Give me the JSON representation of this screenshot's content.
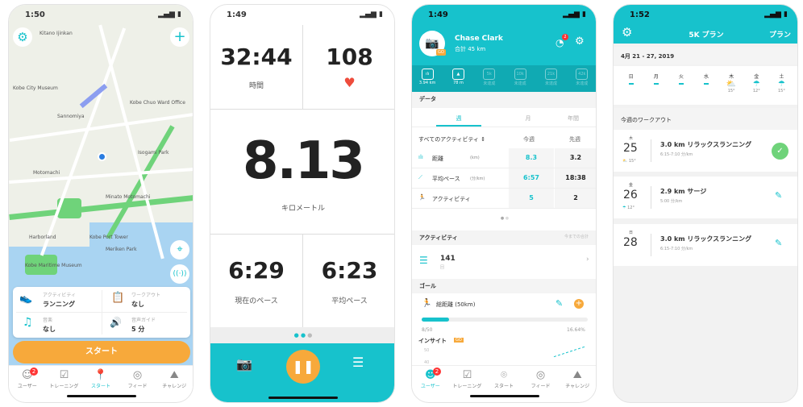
{
  "phone1": {
    "time": "1:50",
    "map_labels": [
      "Kitano Ijinkan",
      "Kobe City Museum",
      "Sannomiya",
      "Harborland",
      "Kobe Port Tower",
      "Meriken Park",
      "Isogami Park",
      "Motomachi",
      "Minato Motomachi",
      "Kobe Chuo Ward Office",
      "Kobe Maritime Museum"
    ],
    "card": [
      {
        "icon": "shoe-icon",
        "label": "アクティビティ",
        "value": "ランニング"
      },
      {
        "icon": "clipboard-icon",
        "label": "ワークアウト",
        "value": "なし"
      },
      {
        "icon": "music-icon",
        "label": "音楽",
        "value": "なし"
      },
      {
        "icon": "speaker-icon",
        "label": "音声ガイド",
        "value": "5 分"
      }
    ],
    "start": "スタート"
  },
  "tabs": [
    "ユーザー",
    "トレーニング",
    "スタート",
    "フィード",
    "チャレンジ"
  ],
  "badge_count": "2",
  "phone2": {
    "time": "1:49",
    "duration": "32:44",
    "duration_label": "時間",
    "heart_rate": "108",
    "distance": "8.13",
    "distance_label": "キロメートル",
    "current_pace": "6:29",
    "current_pace_label": "現在のペース",
    "avg_pace": "6:23",
    "avg_pace_label": "平均ペース"
  },
  "phone3": {
    "time": "1:49",
    "name": "Chase Clark",
    "total": "合計 45 km",
    "avatar_badge": "GO",
    "notif": "2",
    "achievements": [
      {
        "mark": "ılı",
        "label": "3.94 km"
      },
      {
        "mark": "▲",
        "label": "78 m"
      },
      {
        "mark": "5k",
        "label": "未達成"
      },
      {
        "mark": "10k",
        "label": "未達成"
      },
      {
        "mark": "21k",
        "label": "未達成"
      },
      {
        "mark": "42k",
        "label": "未達成"
      }
    ],
    "data_title": "データ",
    "periods": [
      "週",
      "月",
      "年間"
    ],
    "filter": "すべてのアクティビティ",
    "col_this": "今週",
    "col_last": "先週",
    "rows": [
      {
        "label": "距離",
        "unit": "(km)",
        "this": "8.3",
        "last": "3.2"
      },
      {
        "label": "平均ペース",
        "unit": "(分/km)",
        "this": "6:57",
        "last": "18:38"
      },
      {
        "label": "アクティビティ",
        "unit": "",
        "this": "5",
        "last": "2"
      }
    ],
    "activity_title": "アクティビティ",
    "activity_note": "今までの合計",
    "activity_count": "141",
    "activity_unit": "回",
    "goal_title": "ゴール",
    "goal_name": "総距離 (50km)",
    "goal_progress": "8/50",
    "goal_percent": "16.64%",
    "goal_fraction": 0.1664,
    "insight_title": "インサイト",
    "insight_badge": "GO",
    "insight_ticks": [
      "50",
      "40"
    ]
  },
  "phone4": {
    "time": "1:52",
    "title": "5K プラン",
    "right": "プラン",
    "week": "4月 21 - 27, 2019",
    "days": [
      {
        "d": "日",
        "t": ""
      },
      {
        "d": "月",
        "t": ""
      },
      {
        "d": "火",
        "t": ""
      },
      {
        "d": "水",
        "t": ""
      },
      {
        "d": "木",
        "t": "15°",
        "w": "partly-cloudy-icon"
      },
      {
        "d": "金",
        "t": "12°",
        "w": "rain-icon"
      },
      {
        "d": "土",
        "t": "15°",
        "w": "rain-icon"
      }
    ],
    "workouts_title": "今週のワークアウト",
    "workouts": [
      {
        "dow": "木",
        "day": "25",
        "temp": "15°",
        "title": "3.0 km リラックスランニング",
        "pace": "6:15-7:10 分/km",
        "done": true
      },
      {
        "dow": "金",
        "day": "26",
        "temp": "12°",
        "title": "2.9 km サージ",
        "pace": "5:00 分/km",
        "done": false
      },
      {
        "dow": "日",
        "day": "28",
        "temp": "",
        "title": "3.0 km リラックスランニング",
        "pace": "6:15-7:10 分/km",
        "done": false
      }
    ]
  },
  "colors": {
    "teal": "#17c2cc",
    "orange": "#f7a93b",
    "green": "#6fd37a",
    "red": "#ee4c3c"
  }
}
